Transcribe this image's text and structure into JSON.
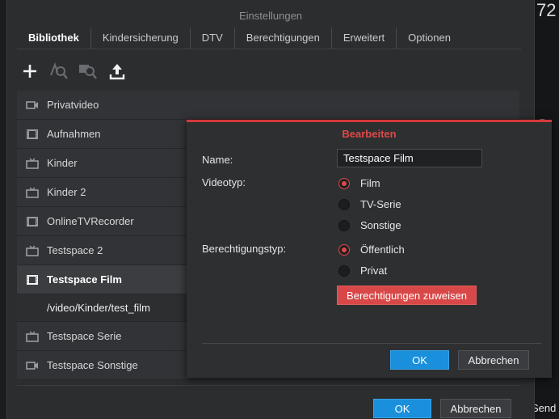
{
  "background": {
    "edge_number": "72",
    "edge_text": "s F",
    "send_label": "Send"
  },
  "settings": {
    "title": "Einstellungen",
    "tabs": [
      {
        "label": "Bibliothek",
        "active": true
      },
      {
        "label": "Kindersicherung"
      },
      {
        "label": "DTV"
      },
      {
        "label": "Berechtigungen"
      },
      {
        "label": "Erweitert"
      },
      {
        "label": "Optionen"
      }
    ],
    "toolbar": [
      "add-icon",
      "search-folder-icon",
      "search-media-icon",
      "upload-icon"
    ],
    "libraries": [
      {
        "label": "Privatvideo",
        "icon": "camera-icon"
      },
      {
        "label": "Aufnahmen",
        "icon": "film-icon"
      },
      {
        "label": "Kinder",
        "icon": "tv-icon"
      },
      {
        "label": "Kinder 2",
        "icon": "tv-icon"
      },
      {
        "label": "OnlineTVRecorder",
        "icon": "film-icon"
      },
      {
        "label": "Testspace 2",
        "icon": "tv-icon"
      },
      {
        "label": "Testspace Film",
        "icon": "film-icon",
        "selected": true
      },
      {
        "label": "/video/Kinder/test_film",
        "sub": true
      },
      {
        "label": "Testspace Serie",
        "icon": "tv-icon"
      },
      {
        "label": "Testspace Sonstige",
        "icon": "camera-icon"
      }
    ],
    "ok_label": "OK",
    "cancel_label": "Abbrechen"
  },
  "dialog": {
    "title": "Bearbeiten",
    "name_label": "Name:",
    "name_value": "Testspace Film",
    "videotype_label": "Videotyp:",
    "videotype_options": [
      {
        "label": "Film",
        "checked": true
      },
      {
        "label": "TV-Serie",
        "checked": false
      },
      {
        "label": "Sonstige",
        "checked": false
      }
    ],
    "permission_label": "Berechtigungstyp:",
    "permission_options": [
      {
        "label": "Öffentlich",
        "checked": true
      },
      {
        "label": "Privat",
        "checked": false
      }
    ],
    "assign_button": "Berechtigungen zuweisen",
    "ok_label": "OK",
    "cancel_label": "Abbrechen"
  },
  "colors": {
    "accent_red": "#d94848",
    "primary_blue": "#1a8fdc"
  }
}
